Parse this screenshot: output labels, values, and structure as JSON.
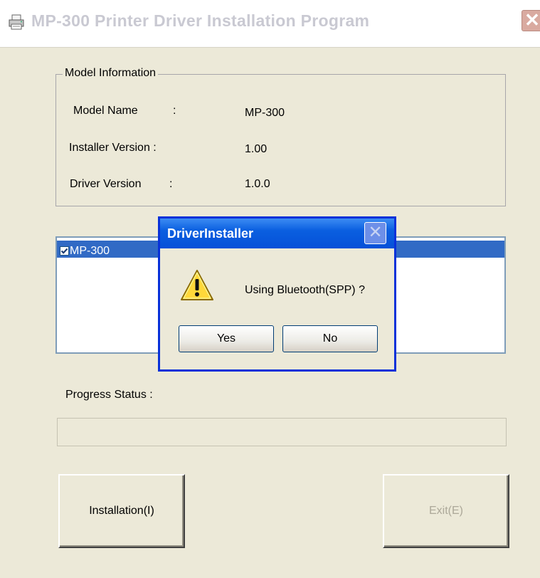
{
  "window": {
    "title": "MP-300 Printer Driver Installation Program",
    "close_symbol": "✕"
  },
  "model_info": {
    "legend": "Model Information",
    "rows": [
      {
        "label": "Model Name",
        "sep": ":",
        "value": "MP-300"
      },
      {
        "label": "Installer Version :",
        "sep": "",
        "value": "1.00"
      },
      {
        "label": "Driver Version",
        "sep": ":",
        "value": "1.0.0"
      }
    ]
  },
  "driver_list": {
    "items": [
      {
        "label": "MP-300",
        "checked": true,
        "selected": true
      }
    ]
  },
  "progress": {
    "label": "Progress Status :",
    "value": 0
  },
  "buttons": {
    "install": "Installation(I)",
    "exit": "Exit(E)"
  },
  "dialog": {
    "title": "DriverInstaller",
    "close_symbol": "✕",
    "icon": "warning-icon",
    "message": "Using Bluetooth(SPP) ?",
    "yes": "Yes",
    "no": "No"
  },
  "colors": {
    "face": "#ECE9D8",
    "selection": "#316AC5",
    "dialog_border": "#0831D9",
    "disabled_text": "#aca899"
  }
}
